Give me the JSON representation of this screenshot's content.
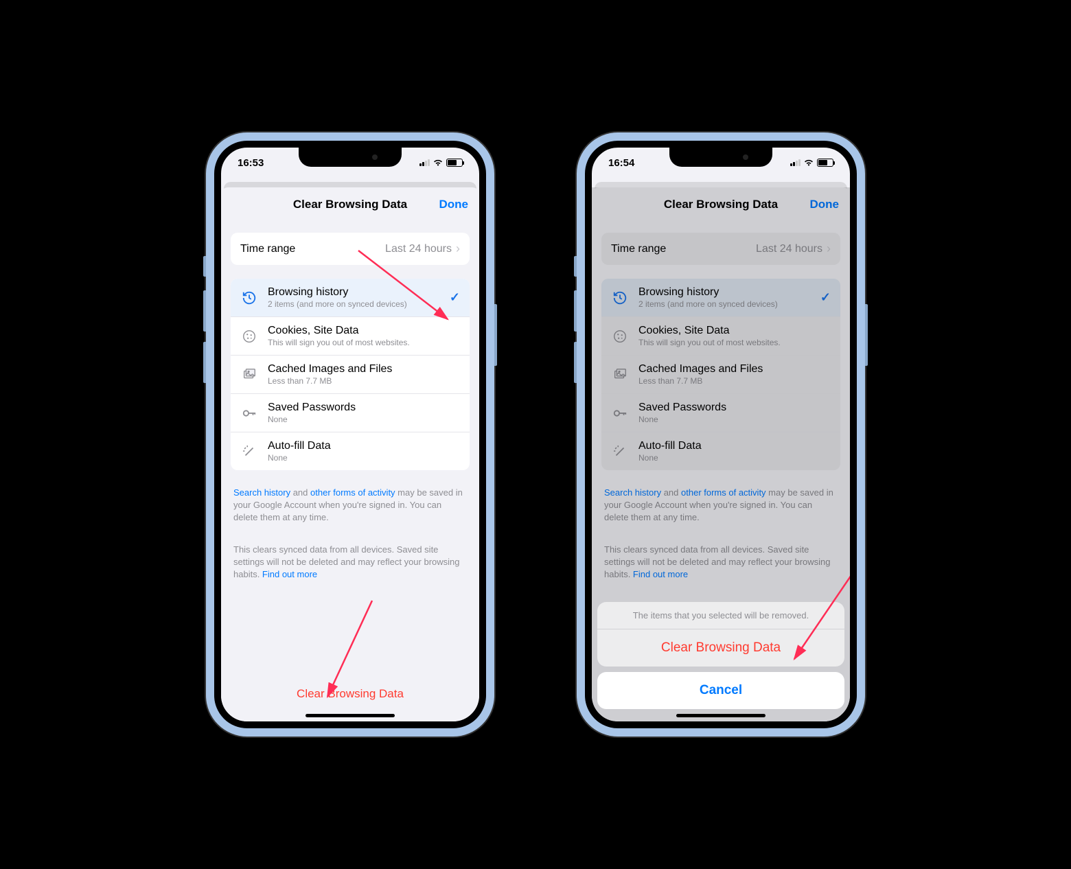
{
  "phone1": {
    "time": "16:53",
    "header": {
      "title": "Clear Browsing Data",
      "done": "Done"
    },
    "timeRange": {
      "label": "Time range",
      "value": "Last 24 hours"
    },
    "options": [
      {
        "title": "Browsing history",
        "sub": "2 items (and more on synced devices)",
        "selected": true,
        "icon": "history"
      },
      {
        "title": "Cookies, Site Data",
        "sub": "This will sign you out of most websites.",
        "selected": false,
        "icon": "cookie"
      },
      {
        "title": "Cached Images and Files",
        "sub": "Less than 7.7 MB",
        "selected": false,
        "icon": "image"
      },
      {
        "title": "Saved Passwords",
        "sub": "None",
        "selected": false,
        "icon": "key"
      },
      {
        "title": "Auto-fill Data",
        "sub": "None",
        "selected": false,
        "icon": "wand"
      }
    ],
    "footer1": {
      "link1": "Search history",
      "mid1": " and ",
      "link2": "other forms of activity",
      "rest": " may be saved in your Google Account when you're signed in. You can delete them at any time."
    },
    "footer2": {
      "text": "This clears synced data from all devices. Saved site settings will not be deleted and may reflect your browsing habits. ",
      "link": "Find out more"
    },
    "clearBtn": "Clear Browsing Data"
  },
  "phone2": {
    "time": "16:54",
    "header": {
      "title": "Clear Browsing Data",
      "done": "Done"
    },
    "timeRange": {
      "label": "Time range",
      "value": "Last 24 hours"
    },
    "options": [
      {
        "title": "Browsing history",
        "sub": "2 items (and more on synced devices)",
        "selected": true,
        "icon": "history"
      },
      {
        "title": "Cookies, Site Data",
        "sub": "This will sign you out of most websites.",
        "selected": false,
        "icon": "cookie"
      },
      {
        "title": "Cached Images and Files",
        "sub": "Less than 7.7 MB",
        "selected": false,
        "icon": "image"
      },
      {
        "title": "Saved Passwords",
        "sub": "None",
        "selected": false,
        "icon": "key"
      },
      {
        "title": "Auto-fill Data",
        "sub": "None",
        "selected": false,
        "icon": "wand"
      }
    ],
    "footer1": {
      "link1": "Search history",
      "mid1": " and ",
      "link2": "other forms of activity",
      "rest": " may be saved in your Google Account when you're signed in. You can delete them at any time."
    },
    "footer2": {
      "text": "This clears synced data from all devices. Saved site settings will not be deleted and may reflect your browsing habits. ",
      "link": "Find out more"
    },
    "actionSheet": {
      "message": "The items that you selected will be removed.",
      "confirm": "Clear Browsing Data",
      "cancel": "Cancel"
    }
  }
}
